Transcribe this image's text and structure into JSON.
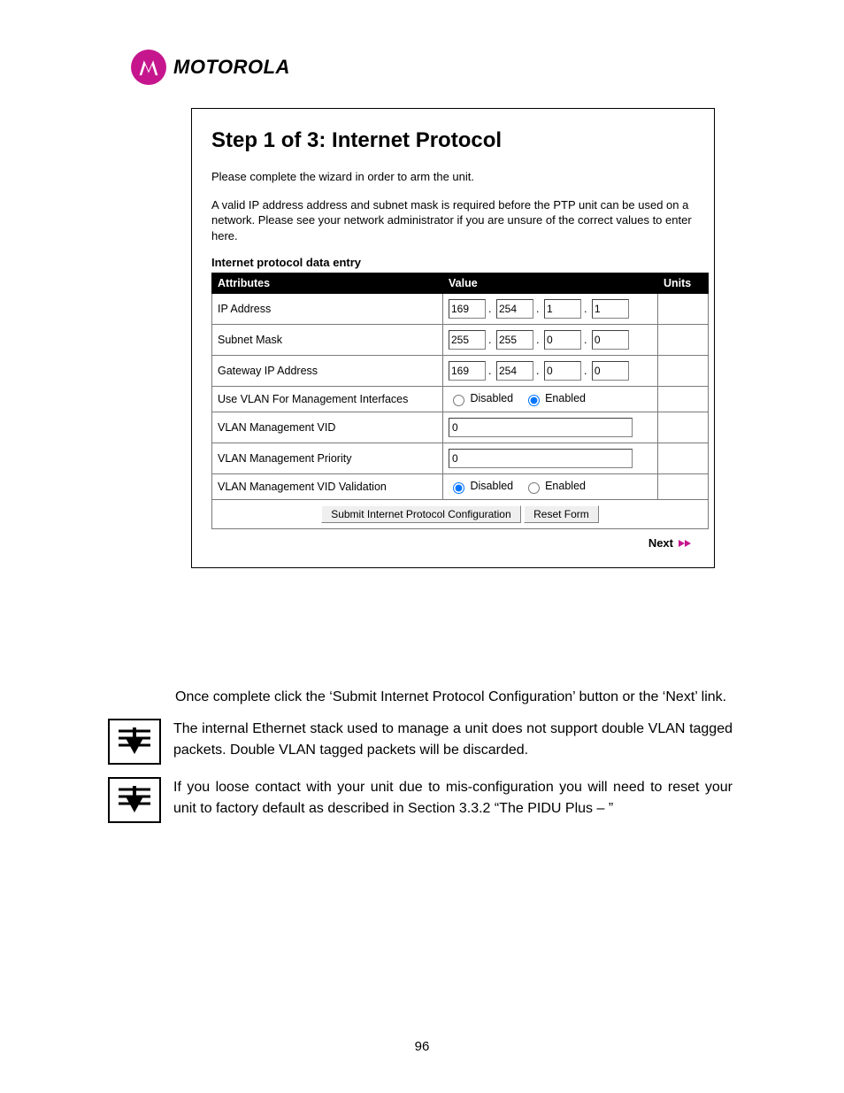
{
  "brand": {
    "name": "MOTOROLA"
  },
  "panel": {
    "title": "Step 1 of 3: Internet Protocol",
    "intro1": "Please complete the wizard in order to arm the unit.",
    "intro2": "A valid IP address address and subnet mask is required before the PTP unit can be used on a network. Please see your network administrator if you are unsure of the correct values to enter here.",
    "subhead": "Internet protocol data entry",
    "headers": {
      "attr": "Attributes",
      "val": "Value",
      "unit": "Units"
    },
    "rows": {
      "ip": {
        "label": "IP Address",
        "oct": [
          "169",
          "254",
          "1",
          "1"
        ]
      },
      "mask": {
        "label": "Subnet Mask",
        "oct": [
          "255",
          "255",
          "0",
          "0"
        ]
      },
      "gw": {
        "label": "Gateway IP Address",
        "oct": [
          "169",
          "254",
          "0",
          "0"
        ]
      },
      "vlanmgmt": {
        "label": "Use VLAN For Management Interfaces",
        "opt_disabled": "Disabled",
        "opt_enabled": "Enabled",
        "selected": "enabled"
      },
      "vid": {
        "label": "VLAN Management VID",
        "value": "0"
      },
      "prio": {
        "label": "VLAN Management Priority",
        "value": "0"
      },
      "vidval": {
        "label": "VLAN Management VID Validation",
        "opt_disabled": "Disabled",
        "opt_enabled": "Enabled",
        "selected": "disabled"
      }
    },
    "buttons": {
      "submit": "Submit Internet Protocol Configuration",
      "reset": "Reset Form"
    },
    "next": "Next"
  },
  "body": {
    "p1": "Once complete click the ‘Submit Internet Protocol Configuration’ button or the ‘Next’ link.",
    "note1": "The internal Ethernet stack used to manage a unit does not support double VLAN tagged packets. Double VLAN tagged packets will be discarded.",
    "note2": "If you loose contact with your unit due to mis-configuration you will need to reset your unit to factory default as described in Section 3.3.2 “The PIDU Plus – ”"
  },
  "page_number": "96"
}
